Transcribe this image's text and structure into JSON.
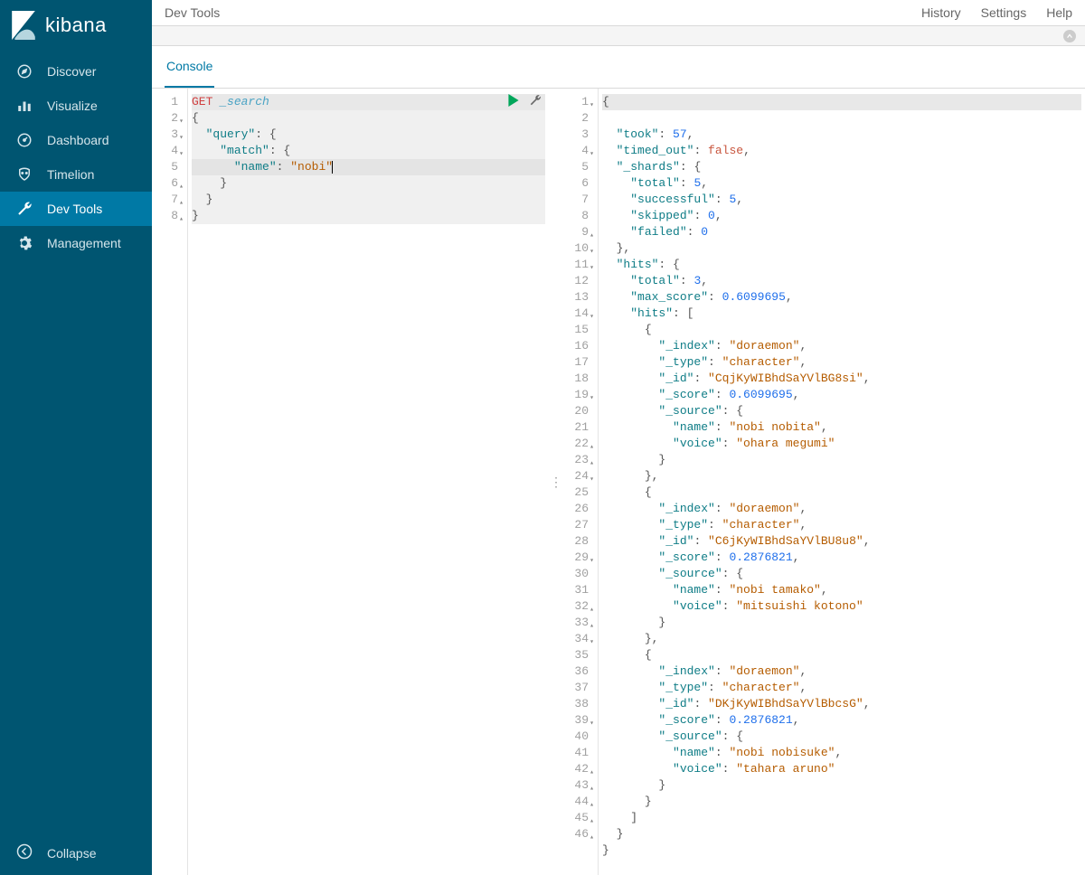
{
  "app": {
    "name": "kibana"
  },
  "sidebar": {
    "items": [
      {
        "id": "discover",
        "label": "Discover",
        "icon": "compass"
      },
      {
        "id": "visualize",
        "label": "Visualize",
        "icon": "barchart"
      },
      {
        "id": "dashboard",
        "label": "Dashboard",
        "icon": "gauge"
      },
      {
        "id": "timelion",
        "label": "Timelion",
        "icon": "shield"
      },
      {
        "id": "devtools",
        "label": "Dev Tools",
        "icon": "wrench"
      },
      {
        "id": "management",
        "label": "Management",
        "icon": "gear"
      }
    ],
    "active": "devtools",
    "collapse_label": "Collapse"
  },
  "topbar": {
    "title": "Dev Tools",
    "links": {
      "history": "History",
      "settings": "Settings",
      "help": "Help"
    }
  },
  "tabs": {
    "console": "Console",
    "active": "console"
  },
  "request": {
    "method": "GET",
    "path": "_search",
    "lines": [
      {
        "n": 1,
        "caret": "",
        "type": "first"
      },
      {
        "n": 2,
        "caret": "down",
        "type": "body"
      },
      {
        "n": 3,
        "caret": "down",
        "type": "body"
      },
      {
        "n": 4,
        "caret": "down",
        "type": "body"
      },
      {
        "n": 5,
        "caret": "",
        "type": "active"
      },
      {
        "n": 6,
        "caret": "up",
        "type": "body"
      },
      {
        "n": 7,
        "caret": "up",
        "type": "body"
      },
      {
        "n": 8,
        "caret": "up",
        "type": "body"
      }
    ],
    "body": {
      "query": {
        "match": {
          "name": "nobi"
        }
      }
    }
  },
  "response": {
    "line_count": 46,
    "carets": {
      "down": [
        1,
        4,
        10,
        11,
        14,
        19,
        24,
        29,
        34,
        39
      ],
      "up": [
        9,
        22,
        23,
        32,
        33,
        42,
        43,
        44,
        45,
        46
      ]
    },
    "body": {
      "took": 57,
      "timed_out": false,
      "_shards": {
        "total": 5,
        "successful": 5,
        "skipped": 0,
        "failed": 0
      },
      "hits": {
        "total": 3,
        "max_score": 0.6099695,
        "hits": [
          {
            "_index": "doraemon",
            "_type": "character",
            "_id": "CqjKyWIBhdSaYVlBG8si",
            "_score": 0.6099695,
            "_source": {
              "name": "nobi nobita",
              "voice": "ohara megumi"
            }
          },
          {
            "_index": "doraemon",
            "_type": "character",
            "_id": "C6jKyWIBhdSaYVlBU8u8",
            "_score": 0.2876821,
            "_source": {
              "name": "nobi tamako",
              "voice": "mitsuishi kotono"
            }
          },
          {
            "_index": "doraemon",
            "_type": "character",
            "_id": "DKjKyWIBhdSaYVlBbcsG",
            "_score": 0.2876821,
            "_source": {
              "name": "nobi nobisuke",
              "voice": "tahara aruno"
            }
          }
        ]
      }
    }
  }
}
